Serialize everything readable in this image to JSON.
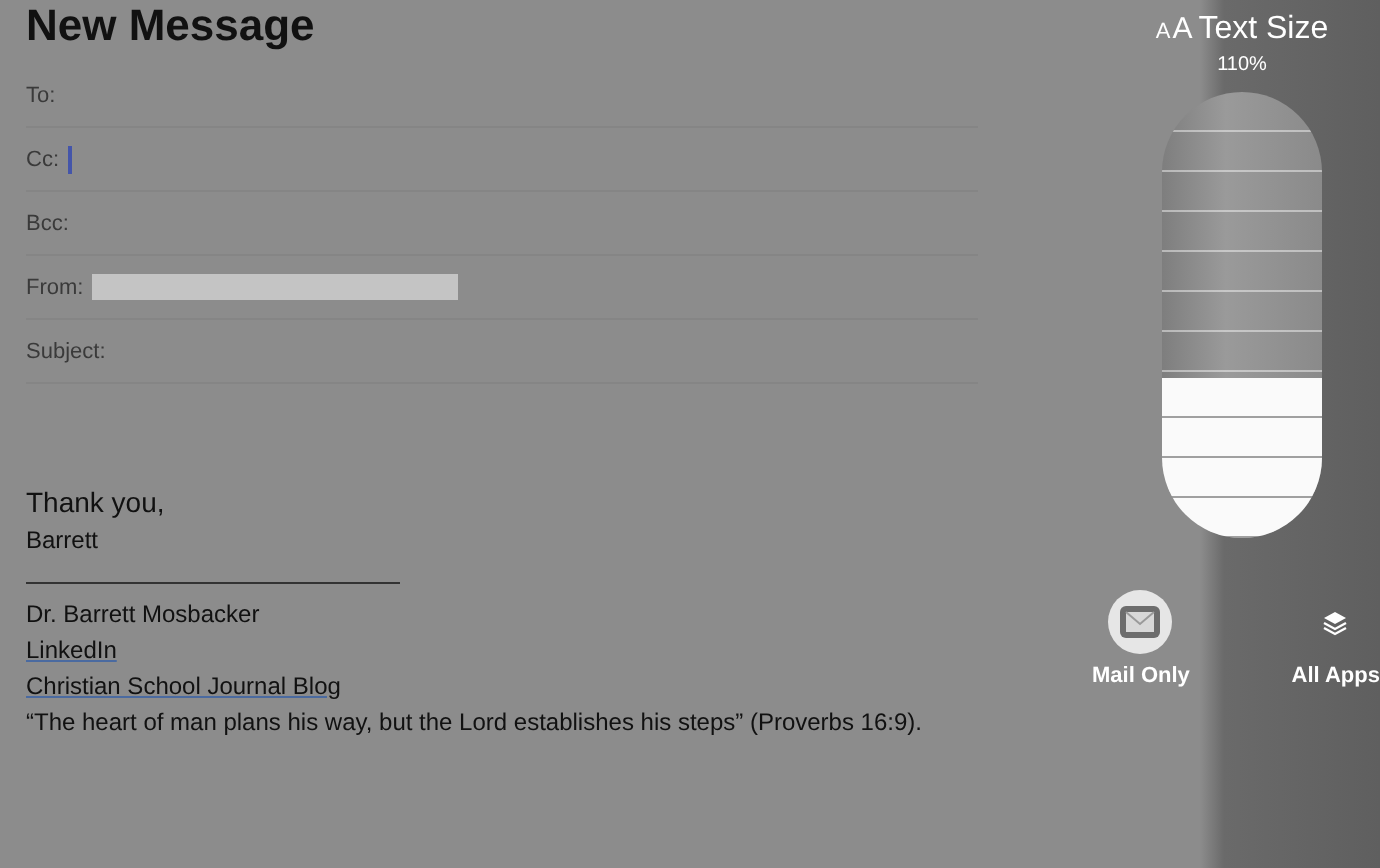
{
  "title": "New Message",
  "fields": [
    {
      "label": "To:",
      "focused": false,
      "redacted": false
    },
    {
      "label": "Cc:",
      "focused": true,
      "redacted": false
    },
    {
      "label": "Bcc:",
      "focused": false,
      "redacted": false
    },
    {
      "label": "From:",
      "focused": false,
      "redacted": true
    },
    {
      "label": "Subject:",
      "focused": false,
      "redacted": false
    }
  ],
  "body": [
    {
      "kind": "greeting",
      "text": "Thank you,"
    },
    {
      "kind": "line",
      "text": "Barrett"
    },
    {
      "kind": "rule"
    },
    {
      "kind": "line",
      "text": "Dr. Barrett Mosbacker"
    },
    {
      "kind": "link",
      "text": "LinkedIn"
    },
    {
      "kind": "link",
      "text": "Christian School Journal Blog"
    },
    {
      "kind": "line",
      "text": "“The heart of man plans his way, but the Lord establishes his steps” (Proverbs 16:9)."
    }
  ],
  "text_size": {
    "small_glyph": "A",
    "large_glyph": "A",
    "title": "Text Size",
    "reading": "110%",
    "level": 0.36,
    "modes": [
      {
        "label": "Mail Only",
        "kind": "mail",
        "selected": true
      },
      {
        "label": "All Apps",
        "kind": "apps",
        "selected": false
      }
    ]
  }
}
